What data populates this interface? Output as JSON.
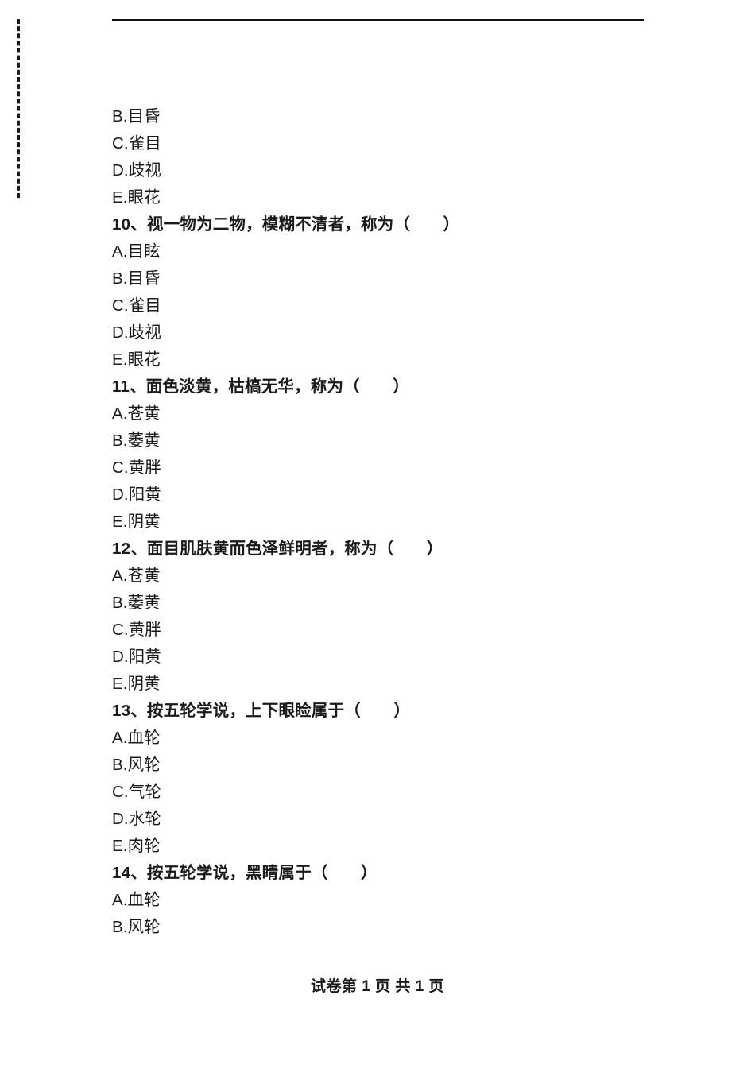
{
  "document": {
    "header_rule_visible": true,
    "binding_dashes_visible": true
  },
  "content": {
    "lines": [
      {
        "kind": "option",
        "text": "B.目昏"
      },
      {
        "kind": "option",
        "text": "C.雀目"
      },
      {
        "kind": "option",
        "text": "D.歧视"
      },
      {
        "kind": "option",
        "text": "E.眼花"
      },
      {
        "kind": "question",
        "text": "10、视一物为二物，模糊不清者，称为（　　）"
      },
      {
        "kind": "option",
        "text": "A.目眩"
      },
      {
        "kind": "option",
        "text": "B.目昏"
      },
      {
        "kind": "option",
        "text": "C.雀目"
      },
      {
        "kind": "option",
        "text": "D.歧视"
      },
      {
        "kind": "option",
        "text": "E.眼花"
      },
      {
        "kind": "question",
        "text": "11、面色淡黄，枯槁无华，称为（　　）"
      },
      {
        "kind": "option",
        "text": "A.苍黄"
      },
      {
        "kind": "option",
        "text": "B.萎黄"
      },
      {
        "kind": "option",
        "text": "C.黄胖"
      },
      {
        "kind": "option",
        "text": "D.阳黄"
      },
      {
        "kind": "option",
        "text": "E.阴黄"
      },
      {
        "kind": "question",
        "text": "12、面目肌肤黄而色泽鲜明者，称为（　　）"
      },
      {
        "kind": "option",
        "text": "A.苍黄"
      },
      {
        "kind": "option",
        "text": "B.萎黄"
      },
      {
        "kind": "option",
        "text": "C.黄胖"
      },
      {
        "kind": "option",
        "text": "D.阳黄"
      },
      {
        "kind": "option",
        "text": "E.阴黄"
      },
      {
        "kind": "question",
        "text": "13、按五轮学说，上下眼睑属于（　　）"
      },
      {
        "kind": "option",
        "text": "A.血轮"
      },
      {
        "kind": "option",
        "text": "B.风轮"
      },
      {
        "kind": "option",
        "text": "C.气轮"
      },
      {
        "kind": "option",
        "text": "D.水轮"
      },
      {
        "kind": "option",
        "text": "E.肉轮"
      },
      {
        "kind": "question",
        "text": "14、按五轮学说，黑睛属于（　　）"
      },
      {
        "kind": "option",
        "text": "A.血轮"
      },
      {
        "kind": "option",
        "text": "B.风轮"
      }
    ]
  },
  "footer": {
    "text": "试卷第 1 页 共 1 页",
    "current_page": "1",
    "total_pages": "1"
  }
}
